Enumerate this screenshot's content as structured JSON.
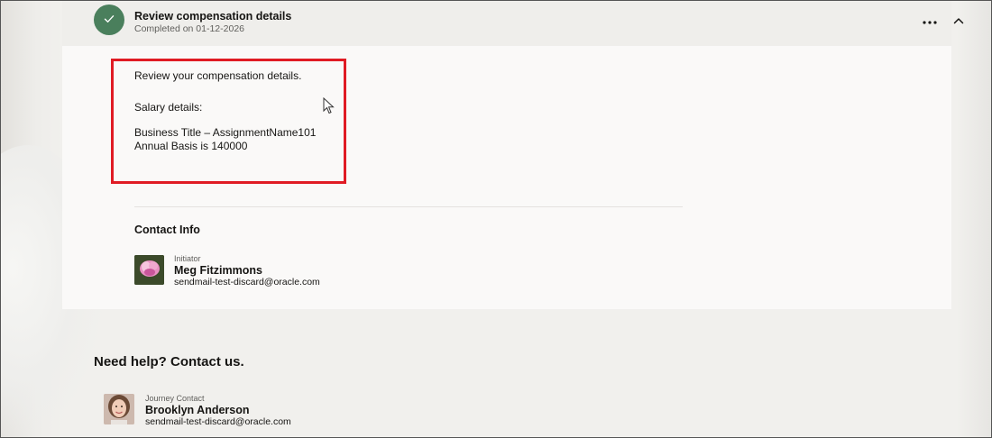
{
  "task": {
    "title": "Review compensation details",
    "status": "Completed on 01-12-2026",
    "status_color": "#4a7f5c"
  },
  "details": {
    "intro": "Review your compensation details.",
    "salary_heading": "Salary details:",
    "business_title": "Business Title – AssignmentName101",
    "annual_basis": "Annual Basis is 140000",
    "highlight_color": "#e01b24"
  },
  "contact_info": {
    "heading": "Contact Info",
    "role": "Initiator",
    "name": "Meg Fitzimmons",
    "email": "sendmail-test-discard@oracle.com"
  },
  "help": {
    "heading": "Need help? Contact us.",
    "role": "Journey Contact",
    "name": "Brooklyn Anderson",
    "email": "sendmail-test-discard@oracle.com"
  },
  "icons": [
    "check-icon",
    "more-options-icon",
    "chevron-up-icon",
    "mouse-cursor-icon"
  ]
}
